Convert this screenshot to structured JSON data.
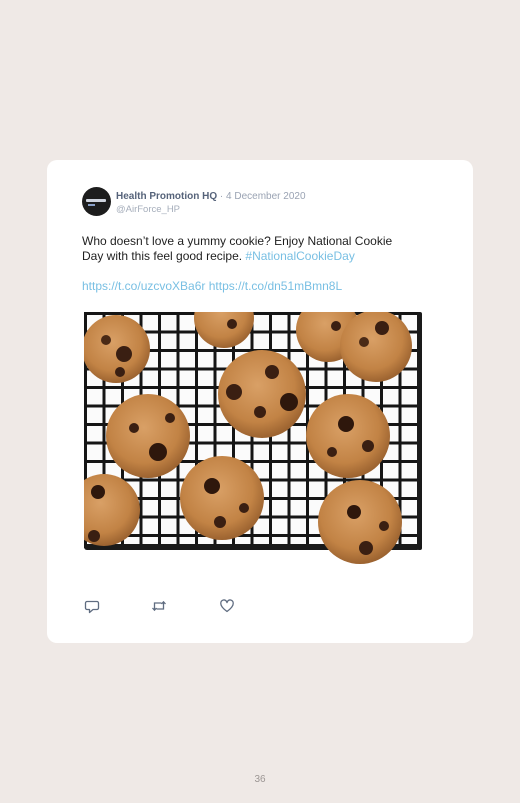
{
  "post": {
    "author_name": "Health Promotion HQ",
    "separator": " · ",
    "date": "4 December 2020",
    "handle": "@AirForce_HP",
    "text_line1": "Who doesn’t love a yummy cookie? Enjoy National Cookie",
    "text_line2": "Day with this feel good recipe. ",
    "hashtag": "#NationalCookieDay",
    "link1": "https://t.co/uzcvoXBa6r",
    "link2": "https://t.co/dn51mBmn8L"
  },
  "actions": {
    "reply_icon": "reply-icon",
    "retweet_icon": "retweet-icon",
    "like_icon": "heart-icon"
  },
  "page": {
    "number": "36"
  }
}
